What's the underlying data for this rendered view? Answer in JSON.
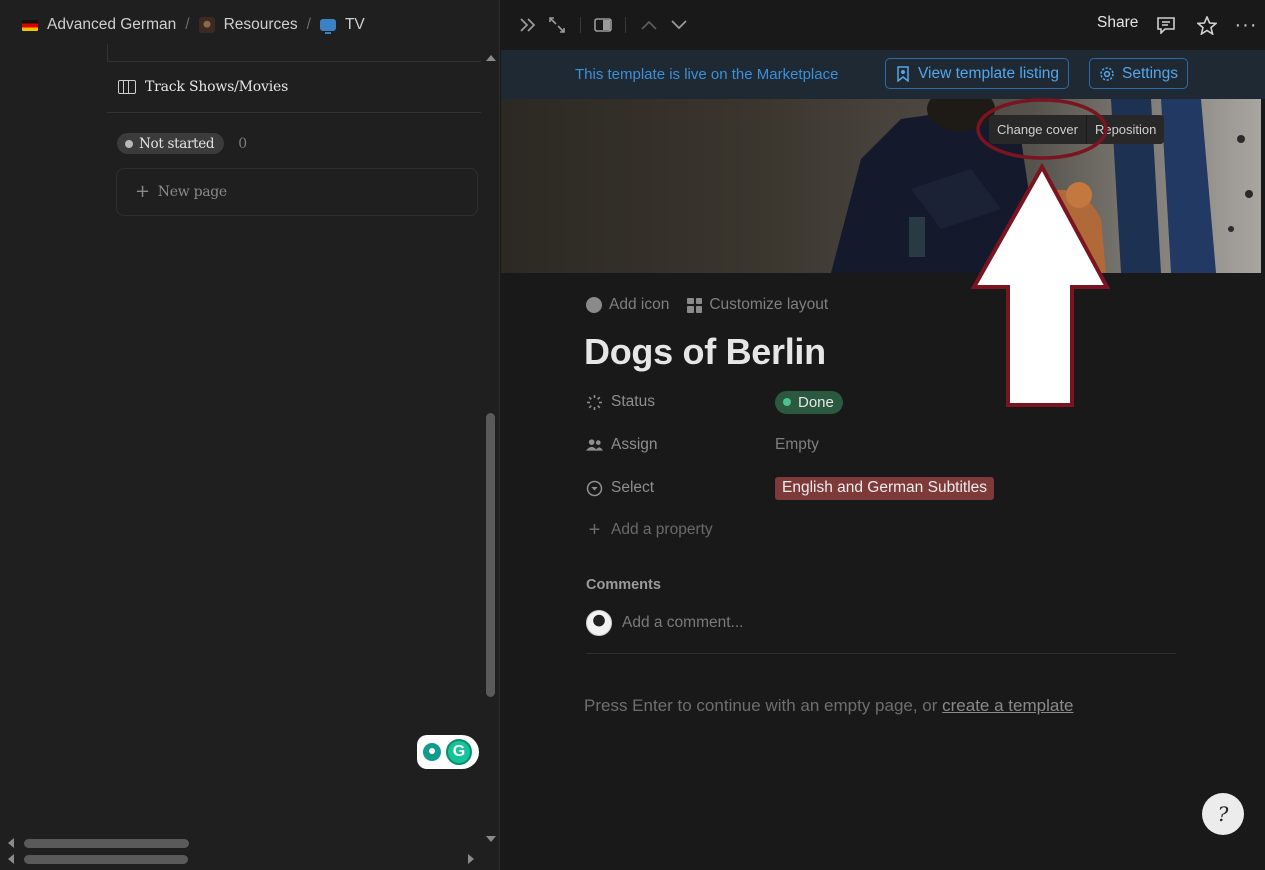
{
  "breadcrumb": [
    {
      "label": "Advanced German",
      "icon": "german-flag-icon"
    },
    {
      "label": "Resources",
      "icon": "resources-icon"
    },
    {
      "label": "TV",
      "icon": "tv-icon"
    }
  ],
  "breadcrumb_separator": "/",
  "sidebar_view": {
    "view_tab_label": "Track Shows/Movies",
    "group_label": "Not started",
    "group_count": "0",
    "new_page_label": "New page"
  },
  "topbar": {
    "share_label": "Share"
  },
  "banner": {
    "text": "This template is live on the Marketplace",
    "view_listing_label": "View template listing",
    "settings_label": "Settings",
    "accent_color": "#3d8fd6"
  },
  "cover": {
    "change_cover_label": "Change cover",
    "reposition_label": "Reposition"
  },
  "page": {
    "add_icon_label": "Add icon",
    "customize_layout_label": "Customize layout",
    "title": "Dogs of Berlin",
    "properties": [
      {
        "label": "Status",
        "value": "Done",
        "icon": "status-icon"
      },
      {
        "label": "Assign",
        "value": "Empty",
        "icon": "people-icon"
      },
      {
        "label": "Select",
        "value": "English and German Subtitles",
        "icon": "select-icon"
      }
    ],
    "add_property_label": "Add a property",
    "comments_heading": "Comments",
    "comment_placeholder": "Add a comment...",
    "hint_text": "Press Enter to continue with an empty page, or ",
    "hint_link": "create a template"
  },
  "colors": {
    "status_done_bg": "#2b593f",
    "select_tag_bg": "#7d3a39",
    "annotation": "#7a1420"
  }
}
